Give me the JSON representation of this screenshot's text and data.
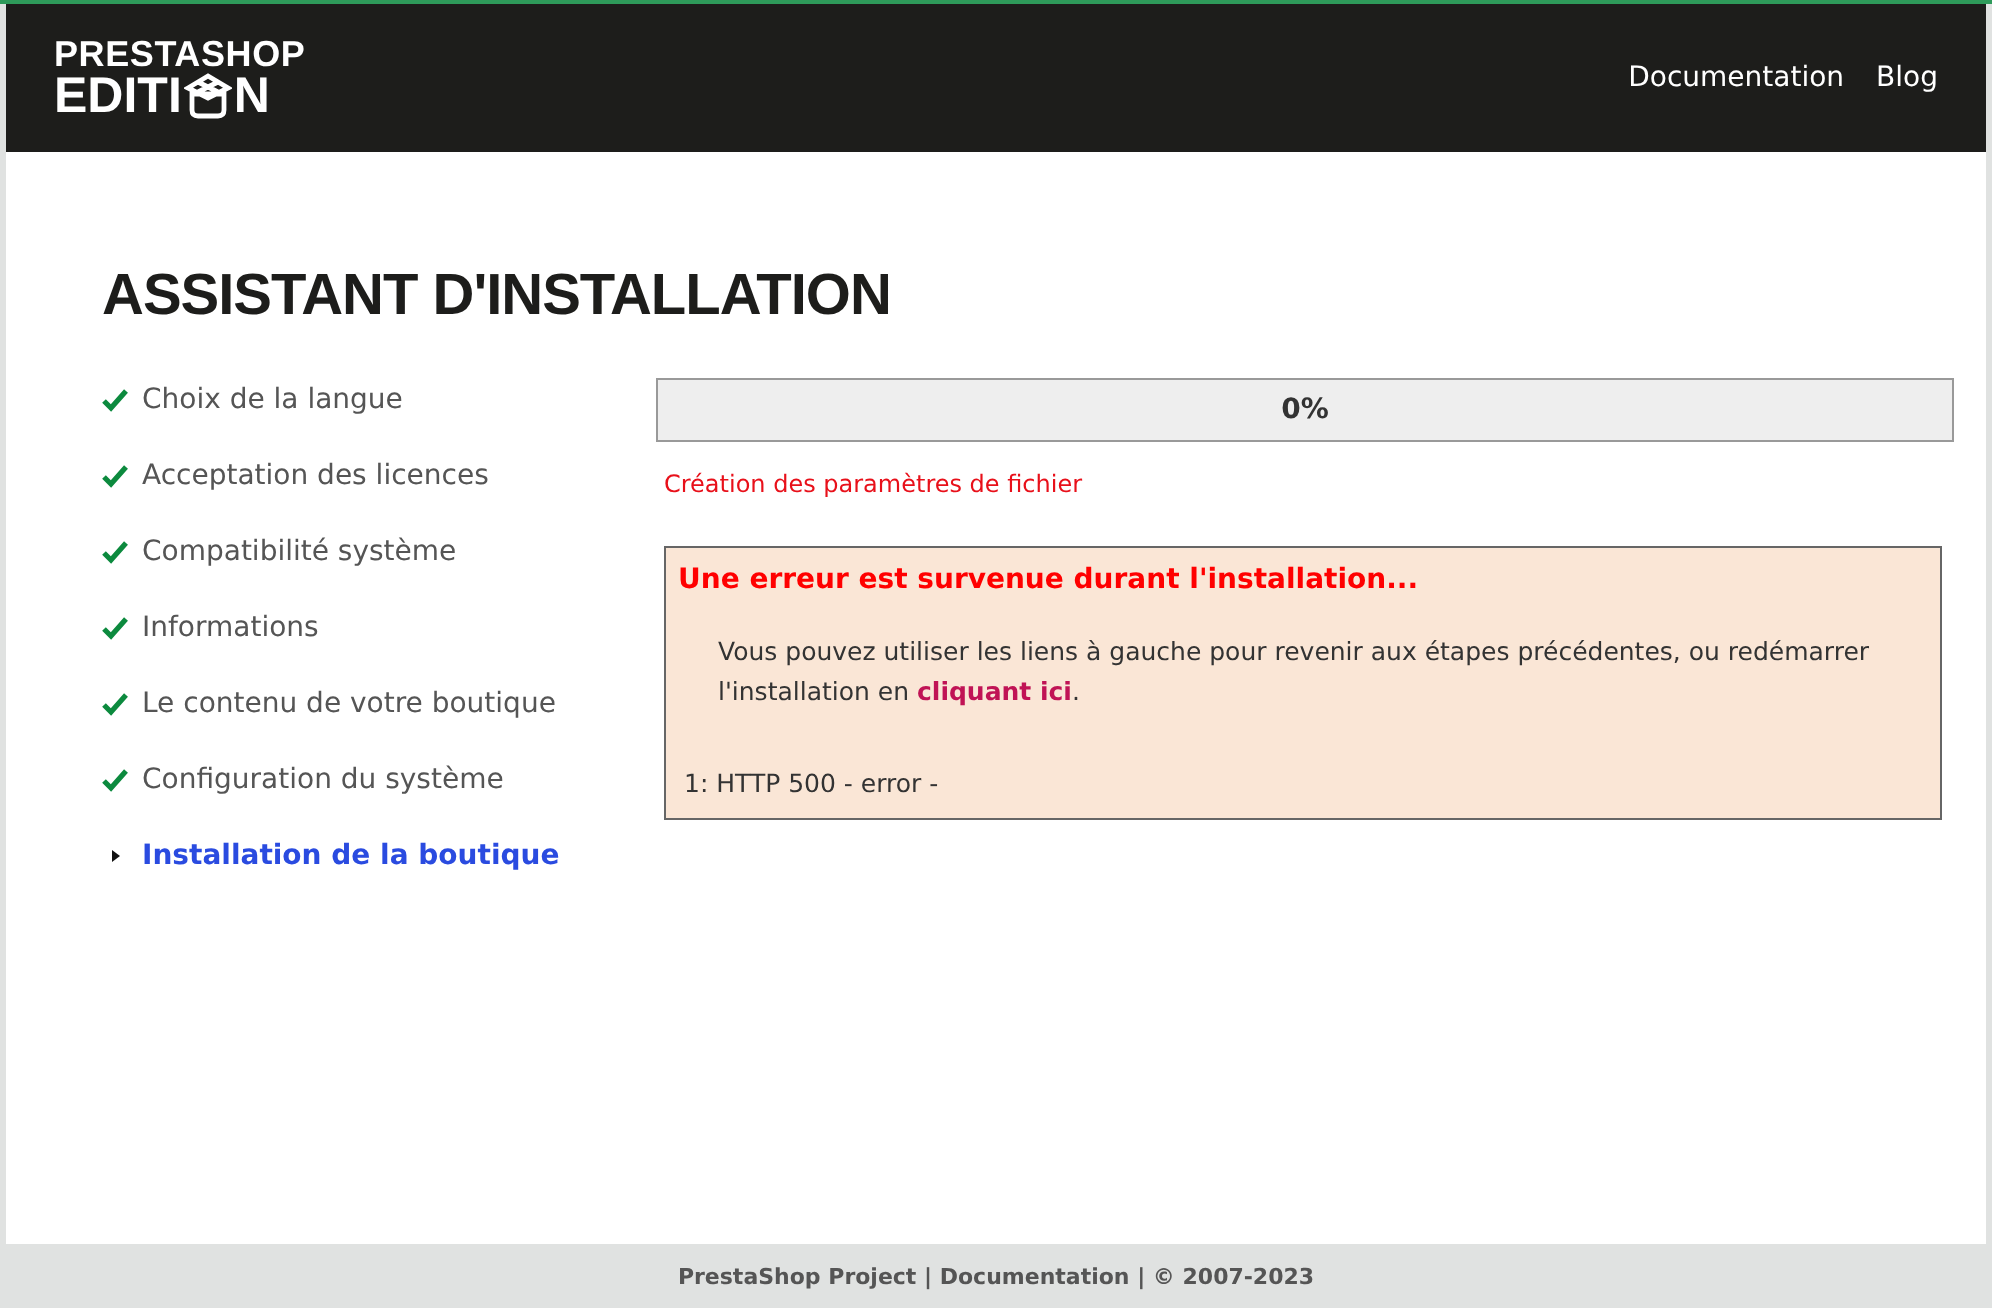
{
  "header": {
    "logo": {
      "line1": "PRESTASHOP",
      "line2_start": "EDITI",
      "line2_end": "N"
    },
    "nav": [
      "Documentation",
      "Blog"
    ]
  },
  "title": "ASSISTANT D'INSTALLATION",
  "steps": [
    {
      "label": "Choix de la langue",
      "checked": true,
      "selected": false
    },
    {
      "label": "Acceptation des licences",
      "checked": true,
      "selected": false
    },
    {
      "label": "Compatibilité système",
      "checked": true,
      "selected": false
    },
    {
      "label": "Informations",
      "checked": true,
      "selected": false
    },
    {
      "label": "Le contenu de votre boutique",
      "checked": true,
      "selected": false
    },
    {
      "label": "Configuration du système",
      "checked": true,
      "selected": false
    },
    {
      "label": "Installation de la boutique",
      "checked": false,
      "selected": true
    }
  ],
  "progress": {
    "level": 0,
    "reading": "0%"
  },
  "status_message": "Création des paramètres de fichier",
  "error": {
    "title": "Une erreur est survenue durant l'installation...",
    "text_before": "Vous pouvez utiliser les liens à gauche pour revenir aux étapes précédentes, ou redémarrer l'installation en ",
    "link": "cliquant ici",
    "text_after": ".",
    "detail": "1: HTTP 500 - error -"
  },
  "footer": "PrestaShop Project | Documentation | © 2007-2023"
}
